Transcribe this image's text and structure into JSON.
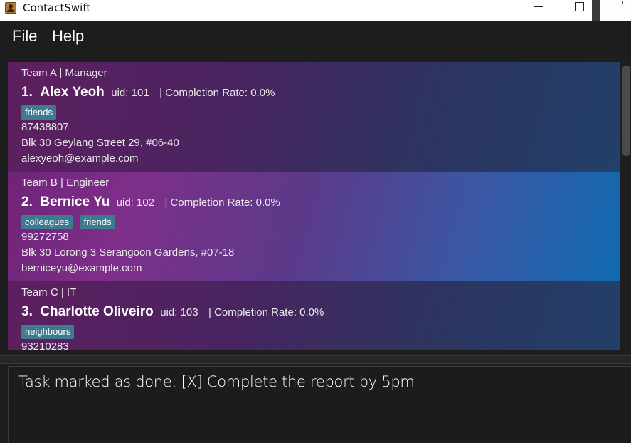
{
  "window": {
    "title": "ContactSwift",
    "icon": "contact-book-icon",
    "controls": [
      "minimize",
      "maximize"
    ]
  },
  "menu": {
    "file": "File",
    "help": "Help"
  },
  "contacts": [
    {
      "team_role": "Team A | Manager",
      "index": "1.",
      "name": "Alex Yeoh",
      "uid": "uid: 101",
      "completion": "| Completion Rate: 0.0%",
      "tags": [
        "friends"
      ],
      "phone": "87438807",
      "address": "Blk 30 Geylang Street 29, #06-40",
      "email": "alexyeoh@example.com",
      "selected": false
    },
    {
      "team_role": "Team B | Engineer",
      "index": "2.",
      "name": "Bernice Yu",
      "uid": "uid: 102",
      "completion": "| Completion Rate: 0.0%",
      "tags": [
        "colleagues",
        "friends"
      ],
      "phone": "99272758",
      "address": "Blk 30 Lorong 3 Serangoon Gardens, #07-18",
      "email": "berniceyu@example.com",
      "selected": true
    },
    {
      "team_role": "Team C | IT",
      "index": "3.",
      "name": "Charlotte Oliveiro",
      "uid": "uid: 103",
      "completion": "| Completion Rate: 0.0%",
      "tags": [
        "neighbours"
      ],
      "phone": "93210283",
      "selected": false
    }
  ],
  "result": {
    "message": "Task marked as done: [X] Complete the report by 5pm"
  },
  "colors": {
    "background": "#1d1d1d",
    "tag": "#3e7b91",
    "selected_card_end": "#0f6ab0"
  }
}
